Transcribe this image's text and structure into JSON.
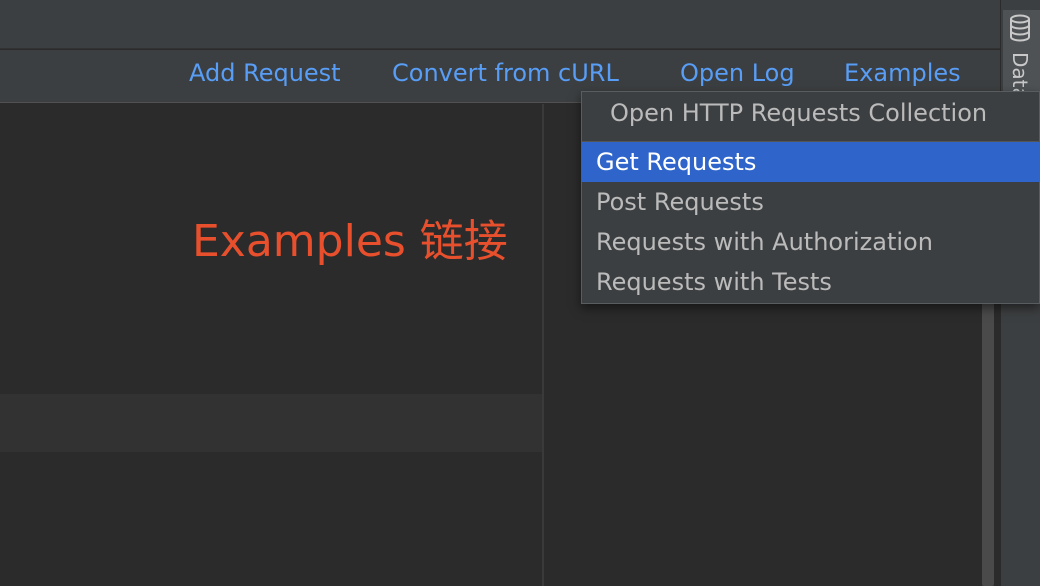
{
  "toolbar": {
    "links": [
      {
        "label": "Add Request"
      },
      {
        "label": "Convert from cURL"
      },
      {
        "label": "Open Log"
      },
      {
        "label": "Examples"
      }
    ]
  },
  "sidebar": {
    "tab_label": "Database",
    "tab_icon": "database-icon"
  },
  "annotation": "Examples 链接",
  "examples_menu": {
    "header": "Open HTTP Requests Collection",
    "items": [
      {
        "label": "Get Requests",
        "selected": true
      },
      {
        "label": "Post Requests",
        "selected": false
      },
      {
        "label": "Requests with Authorization",
        "selected": false
      },
      {
        "label": "Requests with Tests",
        "selected": false
      }
    ]
  },
  "colors": {
    "link": "#589df6",
    "annotation": "#e8502d",
    "selection": "#2f65ca",
    "panel": "#3c3f41",
    "editor": "#2b2b2b"
  }
}
